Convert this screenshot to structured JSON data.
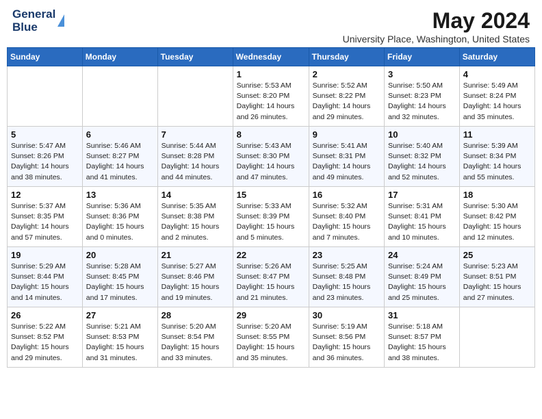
{
  "header": {
    "logo_general": "General",
    "logo_blue": "Blue",
    "title": "May 2024",
    "subtitle": "University Place, Washington, United States"
  },
  "days_of_week": [
    "Sunday",
    "Monday",
    "Tuesday",
    "Wednesday",
    "Thursday",
    "Friday",
    "Saturday"
  ],
  "weeks": [
    [
      {
        "day": "",
        "info": ""
      },
      {
        "day": "",
        "info": ""
      },
      {
        "day": "",
        "info": ""
      },
      {
        "day": "1",
        "info": "Sunrise: 5:53 AM\nSunset: 8:20 PM\nDaylight: 14 hours\nand 26 minutes."
      },
      {
        "day": "2",
        "info": "Sunrise: 5:52 AM\nSunset: 8:22 PM\nDaylight: 14 hours\nand 29 minutes."
      },
      {
        "day": "3",
        "info": "Sunrise: 5:50 AM\nSunset: 8:23 PM\nDaylight: 14 hours\nand 32 minutes."
      },
      {
        "day": "4",
        "info": "Sunrise: 5:49 AM\nSunset: 8:24 PM\nDaylight: 14 hours\nand 35 minutes."
      }
    ],
    [
      {
        "day": "5",
        "info": "Sunrise: 5:47 AM\nSunset: 8:26 PM\nDaylight: 14 hours\nand 38 minutes."
      },
      {
        "day": "6",
        "info": "Sunrise: 5:46 AM\nSunset: 8:27 PM\nDaylight: 14 hours\nand 41 minutes."
      },
      {
        "day": "7",
        "info": "Sunrise: 5:44 AM\nSunset: 8:28 PM\nDaylight: 14 hours\nand 44 minutes."
      },
      {
        "day": "8",
        "info": "Sunrise: 5:43 AM\nSunset: 8:30 PM\nDaylight: 14 hours\nand 47 minutes."
      },
      {
        "day": "9",
        "info": "Sunrise: 5:41 AM\nSunset: 8:31 PM\nDaylight: 14 hours\nand 49 minutes."
      },
      {
        "day": "10",
        "info": "Sunrise: 5:40 AM\nSunset: 8:32 PM\nDaylight: 14 hours\nand 52 minutes."
      },
      {
        "day": "11",
        "info": "Sunrise: 5:39 AM\nSunset: 8:34 PM\nDaylight: 14 hours\nand 55 minutes."
      }
    ],
    [
      {
        "day": "12",
        "info": "Sunrise: 5:37 AM\nSunset: 8:35 PM\nDaylight: 14 hours\nand 57 minutes."
      },
      {
        "day": "13",
        "info": "Sunrise: 5:36 AM\nSunset: 8:36 PM\nDaylight: 15 hours\nand 0 minutes."
      },
      {
        "day": "14",
        "info": "Sunrise: 5:35 AM\nSunset: 8:38 PM\nDaylight: 15 hours\nand 2 minutes."
      },
      {
        "day": "15",
        "info": "Sunrise: 5:33 AM\nSunset: 8:39 PM\nDaylight: 15 hours\nand 5 minutes."
      },
      {
        "day": "16",
        "info": "Sunrise: 5:32 AM\nSunset: 8:40 PM\nDaylight: 15 hours\nand 7 minutes."
      },
      {
        "day": "17",
        "info": "Sunrise: 5:31 AM\nSunset: 8:41 PM\nDaylight: 15 hours\nand 10 minutes."
      },
      {
        "day": "18",
        "info": "Sunrise: 5:30 AM\nSunset: 8:42 PM\nDaylight: 15 hours\nand 12 minutes."
      }
    ],
    [
      {
        "day": "19",
        "info": "Sunrise: 5:29 AM\nSunset: 8:44 PM\nDaylight: 15 hours\nand 14 minutes."
      },
      {
        "day": "20",
        "info": "Sunrise: 5:28 AM\nSunset: 8:45 PM\nDaylight: 15 hours\nand 17 minutes."
      },
      {
        "day": "21",
        "info": "Sunrise: 5:27 AM\nSunset: 8:46 PM\nDaylight: 15 hours\nand 19 minutes."
      },
      {
        "day": "22",
        "info": "Sunrise: 5:26 AM\nSunset: 8:47 PM\nDaylight: 15 hours\nand 21 minutes."
      },
      {
        "day": "23",
        "info": "Sunrise: 5:25 AM\nSunset: 8:48 PM\nDaylight: 15 hours\nand 23 minutes."
      },
      {
        "day": "24",
        "info": "Sunrise: 5:24 AM\nSunset: 8:49 PM\nDaylight: 15 hours\nand 25 minutes."
      },
      {
        "day": "25",
        "info": "Sunrise: 5:23 AM\nSunset: 8:51 PM\nDaylight: 15 hours\nand 27 minutes."
      }
    ],
    [
      {
        "day": "26",
        "info": "Sunrise: 5:22 AM\nSunset: 8:52 PM\nDaylight: 15 hours\nand 29 minutes."
      },
      {
        "day": "27",
        "info": "Sunrise: 5:21 AM\nSunset: 8:53 PM\nDaylight: 15 hours\nand 31 minutes."
      },
      {
        "day": "28",
        "info": "Sunrise: 5:20 AM\nSunset: 8:54 PM\nDaylight: 15 hours\nand 33 minutes."
      },
      {
        "day": "29",
        "info": "Sunrise: 5:20 AM\nSunset: 8:55 PM\nDaylight: 15 hours\nand 35 minutes."
      },
      {
        "day": "30",
        "info": "Sunrise: 5:19 AM\nSunset: 8:56 PM\nDaylight: 15 hours\nand 36 minutes."
      },
      {
        "day": "31",
        "info": "Sunrise: 5:18 AM\nSunset: 8:57 PM\nDaylight: 15 hours\nand 38 minutes."
      },
      {
        "day": "",
        "info": ""
      }
    ]
  ]
}
